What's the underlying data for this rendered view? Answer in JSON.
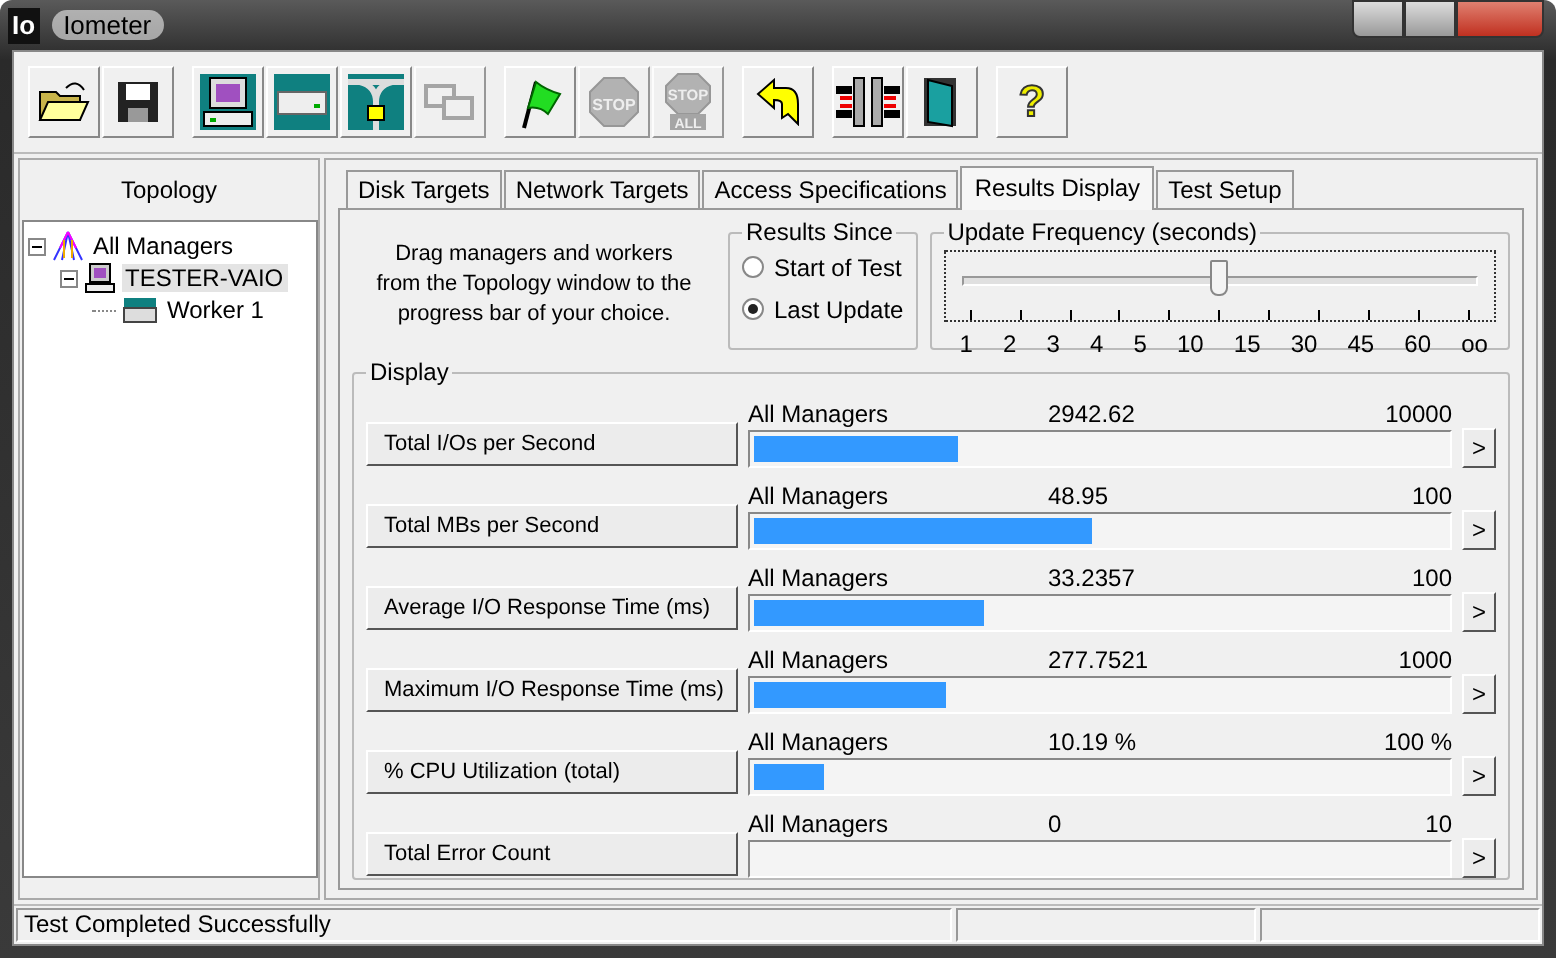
{
  "window": {
    "title": "Iometer",
    "logo": "Io"
  },
  "toolbar": [
    {
      "buttons": [
        {
          "kind": "open",
          "disabled": false
        },
        {
          "kind": "save",
          "disabled": false
        }
      ]
    },
    {
      "buttons": [
        {
          "kind": "manager",
          "disabled": false
        },
        {
          "kind": "disk",
          "disabled": false
        },
        {
          "kind": "network",
          "disabled": false
        },
        {
          "kind": "copy",
          "disabled": true
        }
      ]
    },
    {
      "buttons": [
        {
          "kind": "flag",
          "disabled": false
        },
        {
          "kind": "stop",
          "disabled": true,
          "text": "STOP"
        },
        {
          "kind": "stopall",
          "disabled": true,
          "text": "STOP",
          "text2": "ALL"
        }
      ]
    },
    {
      "buttons": [
        {
          "kind": "back",
          "disabled": false
        }
      ]
    },
    {
      "buttons": [
        {
          "kind": "columns",
          "disabled": false
        },
        {
          "kind": "door",
          "disabled": false
        }
      ]
    },
    {
      "buttons": [
        {
          "kind": "help",
          "disabled": false,
          "text": "?"
        }
      ]
    }
  ],
  "topology": {
    "title": "Topology",
    "tree": [
      {
        "label": "All Managers",
        "kind": "all",
        "expanded": true,
        "selected": false,
        "children": [
          {
            "label": "TESTER-VAIO",
            "kind": "manager",
            "expanded": true,
            "selected": true,
            "children": [
              {
                "label": "Worker 1",
                "kind": "worker",
                "selected": false
              }
            ]
          }
        ]
      }
    ]
  },
  "tabs": [
    {
      "label": "Disk Targets",
      "selected": false
    },
    {
      "label": "Network Targets",
      "selected": false
    },
    {
      "label": "Access Specifications",
      "selected": false
    },
    {
      "label": "Results Display",
      "selected": true
    },
    {
      "label": "Test Setup",
      "selected": false
    }
  ],
  "instructions": "Drag managers and workers from the Topology window to the progress bar of your choice.",
  "results_since": {
    "title": "Results Since",
    "options": [
      {
        "label": "Start of Test",
        "selected": false
      },
      {
        "label": "Last Update",
        "selected": true
      }
    ]
  },
  "update_frequency": {
    "title": "Update Frequency (seconds)",
    "level": 0.5,
    "ticks": [
      "1",
      "2",
      "3",
      "4",
      "5",
      "10",
      "15",
      "30",
      "45",
      "60",
      "oo"
    ]
  },
  "display": {
    "title": "Display",
    "rows": [
      {
        "metric": "Total I/Os per Second",
        "source": "All Managers",
        "value": "2942.62",
        "max": "10000",
        "level": 0.294
      },
      {
        "metric": "Total MBs per Second",
        "source": "All Managers",
        "value": "48.95",
        "max": "100",
        "level": 0.4895
      },
      {
        "metric": "Average I/O Response Time (ms)",
        "source": "All Managers",
        "value": "33.2357",
        "max": "100",
        "level": 0.332
      },
      {
        "metric": "Maximum I/O Response Time (ms)",
        "source": "All Managers",
        "value": "277.7521",
        "max": "1000",
        "level": 0.278
      },
      {
        "metric": "% CPU Utilization (total)",
        "source": "All Managers",
        "value": "10.19 %",
        "max": "100 %",
        "level": 0.102
      },
      {
        "metric": "Total Error Count",
        "source": "All Managers",
        "value": "0",
        "max": "10",
        "level": 0
      }
    ],
    "more_button": ">"
  },
  "status_bar": {
    "text": "Test Completed Successfully"
  }
}
